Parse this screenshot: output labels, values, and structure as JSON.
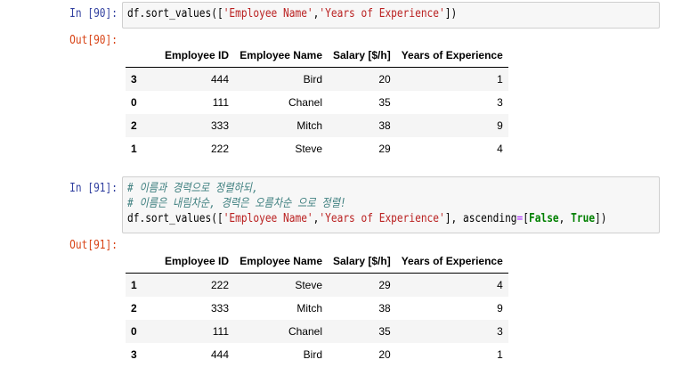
{
  "cells": [
    {
      "in_prompt": "In [90]:",
      "code": [
        "df.sort_values(['Employee Name','Years of Experience'])"
      ],
      "out_prompt": "Out[90]:",
      "table": {
        "columns": [
          "Employee ID",
          "Employee Name",
          "Salary [$/h]",
          "Years of Experience"
        ],
        "rows": [
          {
            "index": "3",
            "values": [
              "444",
              "Bird",
              "20",
              "1"
            ]
          },
          {
            "index": "0",
            "values": [
              "111",
              "Chanel",
              "35",
              "3"
            ]
          },
          {
            "index": "2",
            "values": [
              "333",
              "Mitch",
              "38",
              "9"
            ]
          },
          {
            "index": "1",
            "values": [
              "222",
              "Steve",
              "29",
              "4"
            ]
          }
        ]
      }
    },
    {
      "in_prompt": "In [91]:",
      "code": [
        "# 이름과 경력으로 정렬하되,",
        "# 이름은 내림차순, 경력은 오름차순 으로 정렬!",
        "df.sort_values(['Employee Name','Years of Experience'], ascending=[False, True])"
      ],
      "out_prompt": "Out[91]:",
      "table": {
        "columns": [
          "Employee ID",
          "Employee Name",
          "Salary [$/h]",
          "Years of Experience"
        ],
        "rows": [
          {
            "index": "1",
            "values": [
              "222",
              "Steve",
              "29",
              "4"
            ]
          },
          {
            "index": "2",
            "values": [
              "333",
              "Mitch",
              "38",
              "9"
            ]
          },
          {
            "index": "0",
            "values": [
              "111",
              "Chanel",
              "35",
              "3"
            ]
          },
          {
            "index": "3",
            "values": [
              "444",
              "Bird",
              "20",
              "1"
            ]
          }
        ]
      }
    }
  ],
  "colors": {
    "in_prompt": "#303f9f",
    "out_prompt": "#d84315",
    "comment": "#408080",
    "string": "#ba2121",
    "keyword": "#008000",
    "operator": "#aa22ff"
  }
}
